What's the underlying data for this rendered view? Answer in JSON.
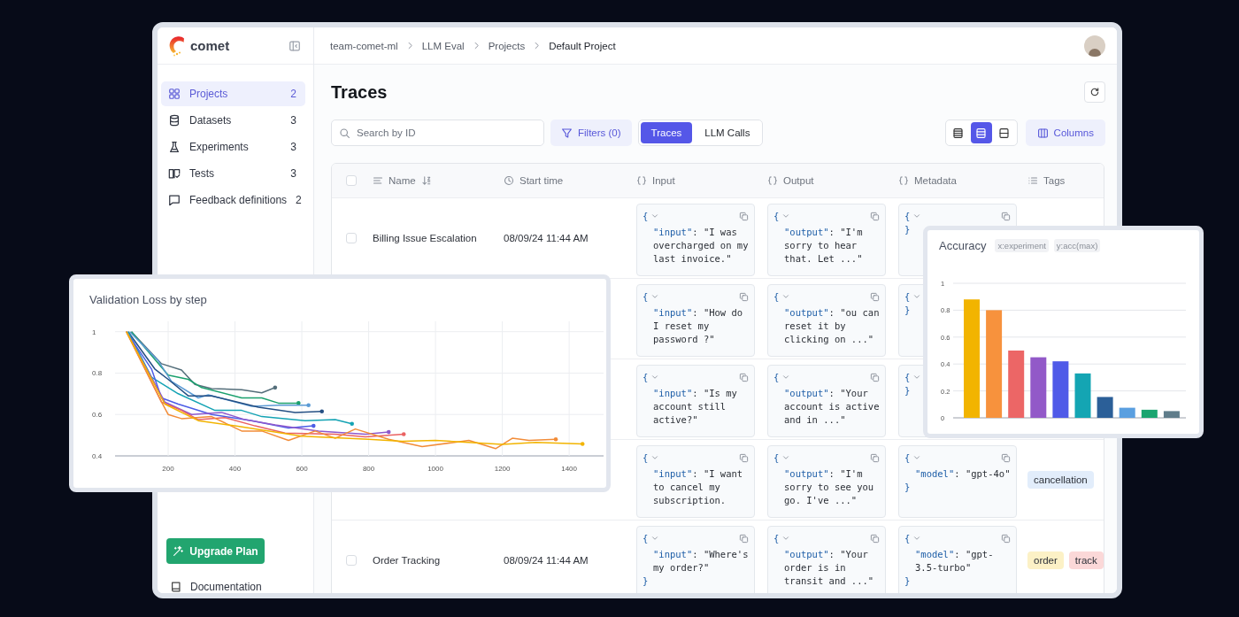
{
  "app": {
    "name": "comet"
  },
  "sidebar": {
    "items": [
      {
        "label": "Projects",
        "count": "2",
        "selected": true
      },
      {
        "label": "Datasets",
        "count": "3",
        "selected": false
      },
      {
        "label": "Experiments",
        "count": "3",
        "selected": false
      },
      {
        "label": "Tests",
        "count": "3",
        "selected": false
      },
      {
        "label": "Feedback definitions",
        "count": "2",
        "selected": false
      }
    ],
    "upgrade_button": "Upgrade Plan",
    "footer_link": "Documentation"
  },
  "breadcrumbs": [
    "team-comet-ml",
    "LLM Eval",
    "Projects",
    "Default Project"
  ],
  "page_title": "Traces",
  "search": {
    "placeholder": "Search by ID"
  },
  "filters_button": "Filters (0)",
  "view_tabs": [
    {
      "label": "Traces",
      "selected": true
    },
    {
      "label": "LLM Calls",
      "selected": false
    }
  ],
  "density_options": [
    {
      "selected": false
    },
    {
      "selected": true
    },
    {
      "selected": false
    }
  ],
  "columns_button": "Columns",
  "table": {
    "select_all": {
      "checked": false
    },
    "columns": [
      {
        "label": "Name",
        "kind": "text"
      },
      {
        "label": "Start time",
        "kind": "time"
      },
      {
        "label": "Input",
        "kind": "json"
      },
      {
        "label": "Output",
        "kind": "json"
      },
      {
        "label": "Metadata",
        "kind": "json"
      },
      {
        "label": "Tags",
        "kind": "tags"
      }
    ],
    "rows": [
      {
        "checked": false,
        "name": "Billing Issue Escalation",
        "start_time": "08/09/24 11:44 AM",
        "input": {
          "open": "{",
          "copy_button": true,
          "key": "\"input\"",
          "value": ": \"I was overcharged on my last invoice.\""
        },
        "output": {
          "open": "{",
          "copy_button": true,
          "key": "\"output\"",
          "value": ": \"I'm sorry to hear that. Let ...\""
        },
        "metadata": {
          "open": "{",
          "copy_button": true,
          "close": "}"
        }
      },
      {
        "input": {
          "open": "{",
          "copy_button": true,
          "key": "\"input\"",
          "value": ": \"How do I reset my password ?\""
        },
        "output": {
          "open": "{",
          "copy_button": true,
          "key": "\"output\"",
          "value": ": \"ou can reset it by clicking on ...\""
        },
        "metadata": {
          "open": "{",
          "close": "}"
        }
      },
      {
        "input": {
          "open": "{",
          "copy_button": true,
          "key": "\"input\"",
          "value": ": \"Is my account still active?\""
        },
        "output": {
          "open": "{",
          "copy_button": true,
          "key": "\"output\"",
          "value": ": \"Your account is active and in ...\""
        },
        "metadata": {
          "open": "{",
          "close": "}"
        }
      },
      {
        "input": {
          "open": "{",
          "copy_button": true,
          "key": "\"input\"",
          "value": ": \"I want to cancel my subscription."
        },
        "output": {
          "open": "{",
          "copy_button": true,
          "key": "\"output\"",
          "value": ": \"I'm sorry to see you go. I've ...\""
        },
        "metadata": {
          "open": "{",
          "copy_button": true,
          "key": "\"model\"",
          "value": ": \"gpt-4o\"",
          "close": "}"
        },
        "tags": [
          {
            "label": "cancellation",
            "color": "#e2edfb"
          }
        ]
      },
      {
        "checked": false,
        "name": "Order Tracking",
        "start_time": "08/09/24 11:44 AM",
        "input": {
          "open": "{",
          "copy_button": true,
          "key": "\"input\"",
          "value": ": \"Where's my order?\"",
          "close": "}"
        },
        "output": {
          "open": "{",
          "copy_button": true,
          "key": "\"output\"",
          "value": ": \"Your order is in transit and ...\""
        },
        "metadata": {
          "open": "{",
          "copy_button": true,
          "key": "\"model\"",
          "value": ": \"gpt-3.5-turbo\"",
          "close": "}"
        },
        "tags": [
          {
            "label": "order",
            "color": "#fcf1c6"
          },
          {
            "label": "track",
            "color": "#fbd8d8"
          }
        ]
      }
    ]
  },
  "validation_chart": {
    "chart_data": {
      "type": "line",
      "title": "Validation Loss by step",
      "grid": true,
      "xlim": [
        41,
        1503
      ],
      "ylim": [
        0.4,
        1.05
      ],
      "xticks": [
        200,
        400,
        600,
        800,
        1000,
        1200,
        1400
      ],
      "yticks": [
        0.4,
        0.6,
        0.8,
        1
      ],
      "series": [
        {
          "color": "#546e7a",
          "x": [
            90,
            180,
            240,
            280,
            330,
            420,
            480,
            520
          ],
          "values": [
            1,
            0.845,
            0.815,
            0.745,
            0.725,
            0.72,
            0.705,
            0.73
          ]
        },
        {
          "color": "#1aa06d",
          "x": [
            90,
            200,
            260,
            300,
            420,
            480,
            530,
            590
          ],
          "values": [
            1,
            0.79,
            0.77,
            0.73,
            0.68,
            0.68,
            0.655,
            0.655
          ]
        },
        {
          "color": "#5b9bd5",
          "x": [
            85,
            170,
            210,
            290,
            320,
            450,
            530,
            620
          ],
          "values": [
            1,
            0.86,
            0.76,
            0.68,
            0.695,
            0.64,
            0.645,
            0.645
          ]
        },
        {
          "color": "#234e83",
          "x": [
            80,
            160,
            200,
            260,
            330,
            470,
            580,
            660
          ],
          "values": [
            1,
            0.82,
            0.77,
            0.69,
            0.69,
            0.635,
            0.61,
            0.615
          ]
        },
        {
          "color": "#14a3b4",
          "x": [
            80,
            150,
            230,
            340,
            420,
            480,
            610,
            700,
            750
          ],
          "values": [
            1,
            0.78,
            0.7,
            0.62,
            0.62,
            0.59,
            0.57,
            0.575,
            0.555
          ]
        },
        {
          "color": "#4c5de6",
          "x": [
            75,
            150,
            180,
            230,
            330,
            450,
            560,
            635
          ],
          "values": [
            1,
            0.82,
            0.68,
            0.65,
            0.6,
            0.57,
            0.535,
            0.545
          ]
        },
        {
          "color": "#8e59cd",
          "x": [
            75,
            160,
            190,
            270,
            360,
            430,
            520,
            650,
            790,
            860
          ],
          "values": [
            1,
            0.75,
            0.66,
            0.6,
            0.61,
            0.575,
            0.55,
            0.52,
            0.505,
            0.515
          ]
        },
        {
          "color": "#ea6262",
          "x": [
            75,
            180,
            240,
            290,
            370,
            460,
            550,
            700,
            790,
            905
          ],
          "values": [
            1,
            0.66,
            0.62,
            0.575,
            0.585,
            0.545,
            0.51,
            0.505,
            0.492,
            0.505
          ]
        },
        {
          "color": "#f28c38",
          "x": [
            75,
            180,
            200,
            240,
            330,
            420,
            480,
            560,
            640,
            700,
            760,
            860,
            960,
            1100,
            1180,
            1230,
            1280,
            1360
          ],
          "values": [
            1,
            0.66,
            0.6,
            0.58,
            0.59,
            0.52,
            0.52,
            0.475,
            0.52,
            0.485,
            0.53,
            0.48,
            0.445,
            0.475,
            0.435,
            0.485,
            0.475,
            0.48
          ]
        },
        {
          "color": "#f2b400",
          "x": [
            75,
            190,
            290,
            400,
            600,
            800,
            900,
            1000,
            1200,
            1300,
            1440
          ],
          "values": [
            1,
            0.65,
            0.57,
            0.545,
            0.495,
            0.48,
            0.47,
            0.475,
            0.455,
            0.465,
            0.458
          ]
        }
      ]
    }
  },
  "accuracy_chart": {
    "chart_data": {
      "type": "bar",
      "title": "Accuracy",
      "xlabel": "x:experiment",
      "ylabel": "y:acc(max)",
      "grid": true,
      "ylim": [
        0,
        1
      ],
      "yticks": [
        0,
        0.2,
        0.4,
        0.6,
        0.8,
        1
      ],
      "series": [
        {
          "color": "#f2b400",
          "values": [
            0.88
          ]
        },
        {
          "color": "#f7923d",
          "values": [
            0.8
          ]
        },
        {
          "color": "#ec6666",
          "values": [
            0.5
          ]
        },
        {
          "color": "#9259c8",
          "values": [
            0.45
          ]
        },
        {
          "color": "#4f5ae8",
          "values": [
            0.42
          ]
        },
        {
          "color": "#14a5b3",
          "values": [
            0.33
          ]
        },
        {
          "color": "#2b5f98",
          "values": [
            0.155
          ]
        },
        {
          "color": "#5a9fe0",
          "values": [
            0.075
          ]
        },
        {
          "color": "#1aa570",
          "values": [
            0.06
          ]
        },
        {
          "color": "#5f7c8a",
          "values": [
            0.05
          ]
        }
      ]
    }
  }
}
